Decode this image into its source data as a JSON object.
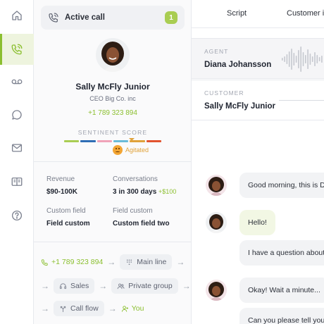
{
  "nav": {
    "items": [
      {
        "name": "home"
      },
      {
        "name": "calls",
        "active": true
      },
      {
        "name": "voicemail"
      },
      {
        "name": "messages"
      },
      {
        "name": "email"
      },
      {
        "name": "knowledge-base"
      },
      {
        "name": "help"
      }
    ]
  },
  "call": {
    "label": "Active call",
    "count": "1"
  },
  "contact": {
    "name": "Sally McFly Junior",
    "company": "CEO Big Co. inc",
    "phone": "+1 789 323 894",
    "sentiment_title": "SENTINENT SCORE",
    "sentiment_status": "Agitated",
    "sentiment_colors": [
      "#a9cd52",
      "#2f6db5",
      "#f0a3b8",
      "#6bbbd9",
      "#e0a23a",
      "#e2532f"
    ]
  },
  "stats": {
    "revenue_label": "Revenue",
    "revenue_value": "$90-100K",
    "conversations_label": "Conversations",
    "conversations_value": "3 in 300 days",
    "conversations_extra": "+$100",
    "custom1_label": "Custom field",
    "custom1_value": "Field custom",
    "custom2_label": "Field custom",
    "custom2_value": "Custom field two"
  },
  "flow": {
    "phone": "+1 789 323 894",
    "main_line": "Main line",
    "sales": "Sales",
    "private_group": "Private group",
    "call_flow": "Call flow",
    "you": "You"
  },
  "tabs": [
    "Script",
    "Customer i"
  ],
  "agent": {
    "role": "AGENT",
    "name": "Diana Johansson"
  },
  "customer": {
    "role": "CUSTOMER",
    "name": "Sally McFly Junior"
  },
  "messages": [
    {
      "text": "Good morning, this is D"
    },
    {
      "text": "Hello!"
    },
    {
      "text": "I have a question about p"
    },
    {
      "text": "Okay! Wait a minute..."
    },
    {
      "text": "Can you please tell your"
    }
  ],
  "colors": {
    "accent": "#8bbf2f",
    "agitated": "#e0a23a"
  }
}
